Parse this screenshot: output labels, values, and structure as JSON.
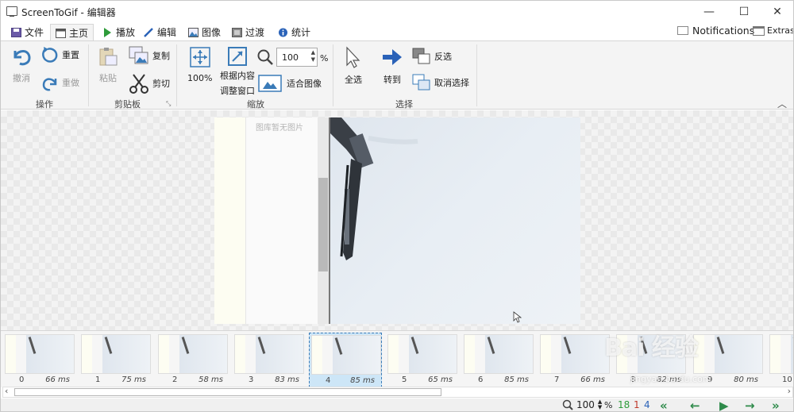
{
  "window": {
    "title": "ScreenToGif - 编辑器",
    "min": "—",
    "max": "☐",
    "close": "✕"
  },
  "tabs": [
    {
      "label": "文件",
      "icon": "save-icon"
    },
    {
      "label": "主页",
      "icon": "home-icon"
    },
    {
      "label": "播放",
      "icon": "play-icon"
    },
    {
      "label": "编辑",
      "icon": "pencil-icon"
    },
    {
      "label": "图像",
      "icon": "image-icon"
    },
    {
      "label": "过渡",
      "icon": "transition-icon"
    },
    {
      "label": "统计",
      "icon": "info-icon"
    }
  ],
  "topright": {
    "notifications": "Notifications",
    "extras": "Extras"
  },
  "ribbon": {
    "undo": "撤消",
    "reset": "重置",
    "redo": "重做",
    "group_action": "操作",
    "paste": "粘贴",
    "copy": "复制",
    "cut": "剪切",
    "group_clipboard": "剪贴板",
    "zoom100": "100%",
    "fit_content_1": "根据内容",
    "fit_content_2": "调整窗口",
    "zoom_value": "100",
    "zoom_pct": "%",
    "fit_image": "适合图像",
    "group_zoom": "缩放",
    "select_all": "全选",
    "goto": "转到",
    "invert": "反选",
    "deselect": "取消选择",
    "group_select": "选择"
  },
  "canvas": {
    "empty_text": "图库暂无图片"
  },
  "frames": [
    {
      "index": "0",
      "ms": "66 ms"
    },
    {
      "index": "1",
      "ms": "75 ms"
    },
    {
      "index": "2",
      "ms": "58 ms"
    },
    {
      "index": "3",
      "ms": "83 ms"
    },
    {
      "index": "4",
      "ms": "85 ms",
      "selected": true
    },
    {
      "index": "5",
      "ms": "65 ms"
    },
    {
      "index": "6",
      "ms": "85 ms"
    },
    {
      "index": "7",
      "ms": "66 ms"
    },
    {
      "index": "8",
      "ms": "82 ms"
    },
    {
      "index": "9",
      "ms": "80 ms"
    },
    {
      "index": "10",
      "ms": ""
    }
  ],
  "status": {
    "zoom": "100",
    "pct": "%",
    "total": "18",
    "selected_count": "1",
    "current": "4"
  },
  "watermark": {
    "brand": "Bai 经验",
    "url": "jingyan.baidu.com"
  }
}
